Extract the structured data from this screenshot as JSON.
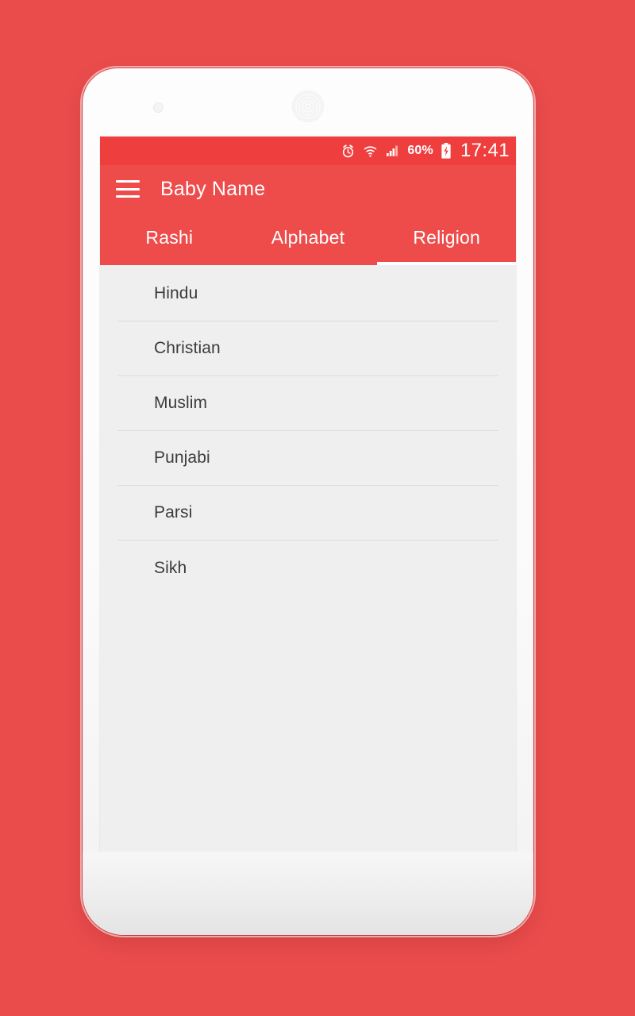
{
  "theme": {
    "wallpaper_red": "#ea4c4c",
    "status_bar_red": "#ee3f3e",
    "app_bar_red": "#ee4c4b",
    "content_gray": "#efefef",
    "text_dark": "#3b3b3b",
    "accent_white": "#ffffff"
  },
  "device": {
    "camera_icon": "camera-dot",
    "earpiece_icon": "earpiece-speaker"
  },
  "status_bar": {
    "alarm_icon": "alarm-clock-icon",
    "wifi_icon": "wifi-icon",
    "signal_icon": "cellular-signal-icon",
    "battery_percent": "60%",
    "battery_icon": "battery-charging-icon",
    "time": "17:41"
  },
  "app_bar": {
    "menu_icon": "hamburger-menu-icon",
    "title": "Baby Name"
  },
  "tabs": [
    {
      "label": "Rashi",
      "active": false
    },
    {
      "label": "Alphabet",
      "active": false
    },
    {
      "label": "Religion",
      "active": true
    }
  ],
  "religion_list": [
    {
      "label": "Hindu"
    },
    {
      "label": "Christian"
    },
    {
      "label": "Muslim"
    },
    {
      "label": "Punjabi"
    },
    {
      "label": "Parsi"
    },
    {
      "label": "Sikh"
    }
  ]
}
